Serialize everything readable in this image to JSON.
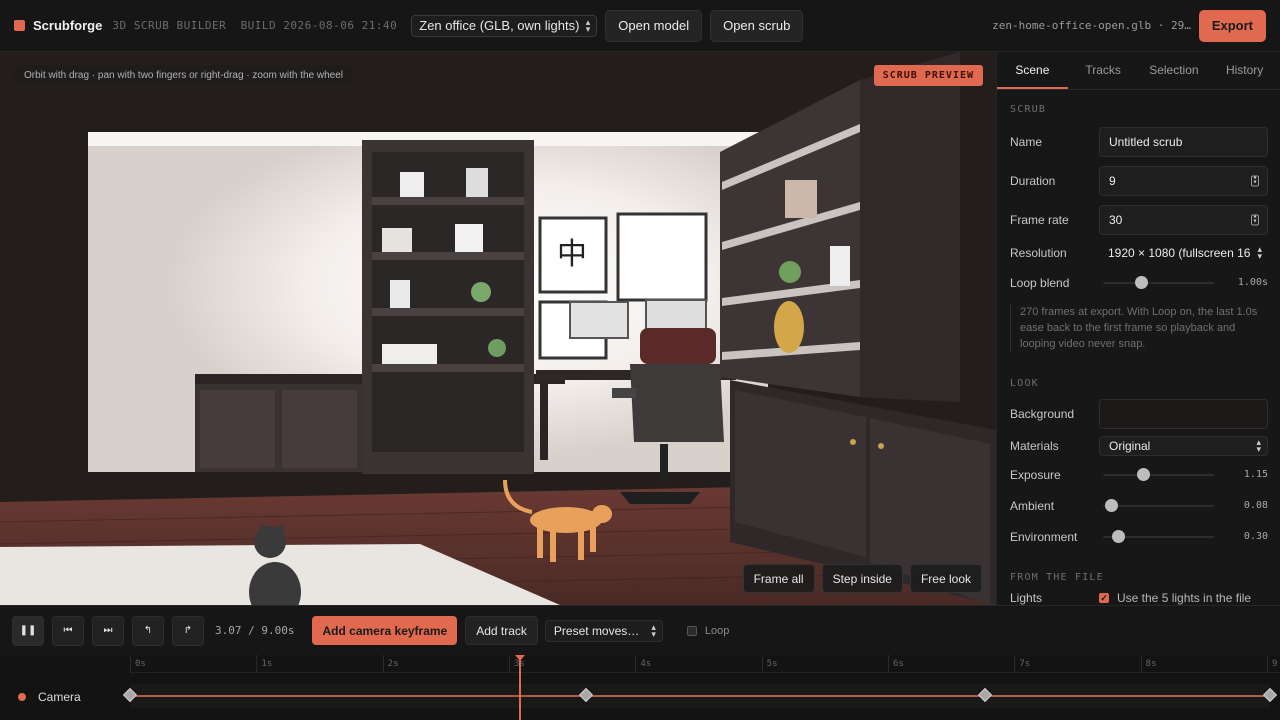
{
  "app": {
    "name": "Scrubforge",
    "subtitle": "3D SCRUB BUILDER",
    "build": "BUILD 2026-08-06 21:40",
    "model_select": "Zen office (GLB, own lights)",
    "open_model": "Open model",
    "open_scrub": "Open scrub",
    "filename": "zen-home-office-open.glb · 29…",
    "export": "Export",
    "accent": "#e0694f"
  },
  "viewport": {
    "hint": "Orbit with drag · pan with two fingers or right-drag · zoom with the wheel",
    "badge": "SCRUB PREVIEW",
    "buttons": [
      "Frame all",
      "Step inside",
      "Free look"
    ]
  },
  "panel": {
    "tabs": [
      "Scene",
      "Tracks",
      "Selection",
      "History"
    ],
    "active_tab": "Scene",
    "scrub_heading": "SCRUB",
    "name_label": "Name",
    "name_value": "Untitled scrub",
    "duration_label": "Duration",
    "duration_value": "9",
    "framerate_label": "Frame rate",
    "framerate_value": "30",
    "resolution_label": "Resolution",
    "resolution_value": "1920 × 1080 (fullscreen 16",
    "loop_blend_label": "Loop blend",
    "loop_blend_value": "1.00s",
    "loop_blend_level": 0.38,
    "note": "270 frames at export. With Loop on, the last 1.0s ease back to the first frame so playback and looping video never snap.",
    "look_heading": "LOOK",
    "background_label": "Background",
    "materials_label": "Materials",
    "materials_value": "Original",
    "exposure_label": "Exposure",
    "exposure_value": "1.15",
    "exposure_level": 0.4,
    "ambient_label": "Ambient",
    "ambient_value": "0.08",
    "ambient_level": 0.08,
    "environment_label": "Environment",
    "environment_value": "0.30",
    "environment_level": 0.15,
    "file_heading": "FROM THE FILE",
    "lights_label": "Lights",
    "lights_check": "Use the 5 lights in the file"
  },
  "transport": {
    "time": "3.07 / 9.00s",
    "add_keyframe": "Add camera keyframe",
    "add_track": "Add track",
    "preset": "Preset moves…",
    "loop": "Loop"
  },
  "timeline": {
    "ticks": [
      "0s",
      "1s",
      "2s",
      "3s",
      "4s",
      "5s",
      "6s",
      "7s",
      "8s",
      "9"
    ],
    "track_name": "Camera",
    "keyframes_s": [
      0,
      3.6,
      6.75,
      9
    ],
    "playhead_s": 3.07,
    "duration_s": 9
  }
}
